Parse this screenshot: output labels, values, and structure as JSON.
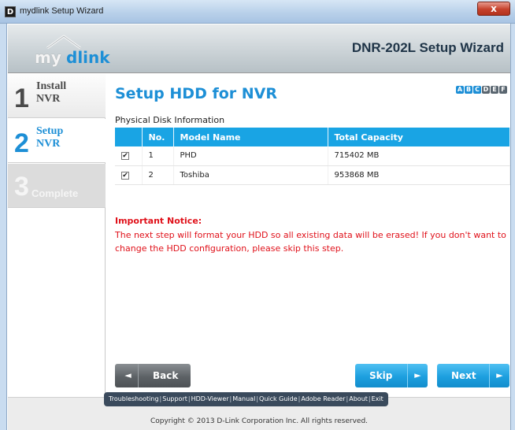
{
  "window": {
    "icon_letter": "D",
    "title": "mydlink Setup Wizard",
    "close_glyph": "x"
  },
  "header": {
    "logo_my": "my",
    "logo_link": "dlink",
    "wizard_title": "DNR-202L Setup Wizard"
  },
  "steps": [
    {
      "number": "1",
      "line1": "Install",
      "line2": "NVR",
      "state": "done"
    },
    {
      "number": "2",
      "line1": "Setup",
      "line2": "NVR",
      "state": "active"
    },
    {
      "number": "3",
      "line1": "",
      "line2": "Complete",
      "state": "disabled"
    }
  ],
  "main": {
    "title": "Setup HDD for NVR",
    "font_size_letters": [
      "A",
      "B",
      "C",
      "D",
      "E",
      "F"
    ],
    "section_label": "Physical Disk Information",
    "table": {
      "headers": [
        "",
        "No.",
        "Model Name",
        "Total Capacity"
      ],
      "rows": [
        {
          "checked": "✔",
          "no": "1",
          "model": "PHD",
          "capacity": "715402 MB"
        },
        {
          "checked": "✔",
          "no": "2",
          "model": "Toshiba",
          "capacity": "953868 MB"
        }
      ]
    },
    "notice_title": "Important Notice:",
    "notice_text": "The next step will format your HDD so all existing data will be erased! If you don't want to change the HDD configuration, please skip this step."
  },
  "buttons": {
    "back": "Back",
    "skip": "Skip",
    "next": "Next",
    "back_arrow": "◄",
    "forward_arrow": "►"
  },
  "footer": {
    "links": [
      "Troubleshooting",
      "Support",
      "HDD-Viewer",
      "Manual",
      "Quick Guide",
      "Adobe Reader",
      "About",
      "Exit"
    ],
    "separator": "|",
    "copyright": "Copyright © 2013 D-Link Corporation Inc. All rights reserved."
  },
  "colors": {
    "accent": "#1d8fd6",
    "table_header": "#19a4e4",
    "notice": "#e0111a"
  }
}
